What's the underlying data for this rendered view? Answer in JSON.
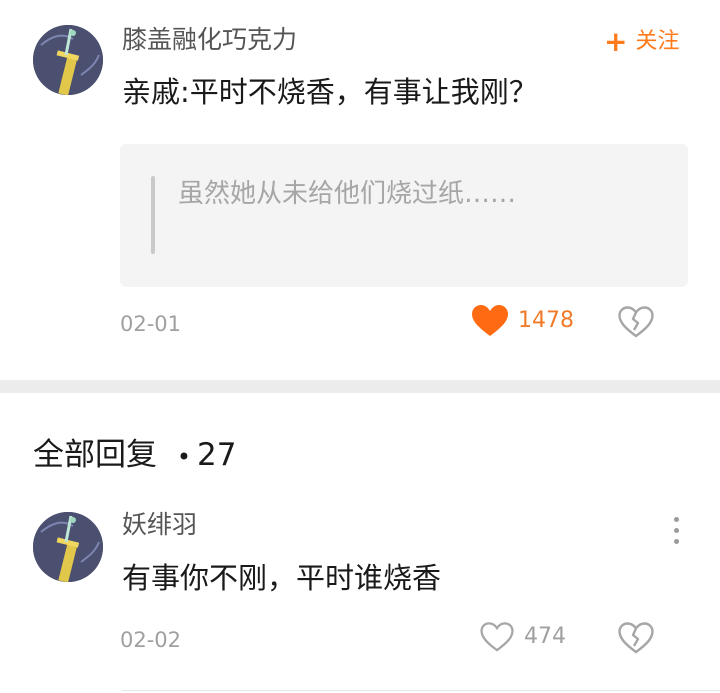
{
  "post": {
    "username": "膝盖融化巧克力",
    "follow_label": "关注",
    "content": "亲戚:平时不烧香，有事让我刚？",
    "quote": "虽然她从未给他们烧过纸……",
    "date": "02-01",
    "like_count": "1478",
    "avatar_icon": "sword-avatar-icon"
  },
  "replies_header": {
    "label": "全部回复",
    "separator": "•",
    "count": "27"
  },
  "reply": {
    "username": "妖绯羽",
    "content": "有事你不刚，平时谁烧香",
    "date": "02-02",
    "like_count": "474"
  },
  "colors": {
    "accent": "#ff7a1a",
    "like_active": "#f07b2b"
  }
}
